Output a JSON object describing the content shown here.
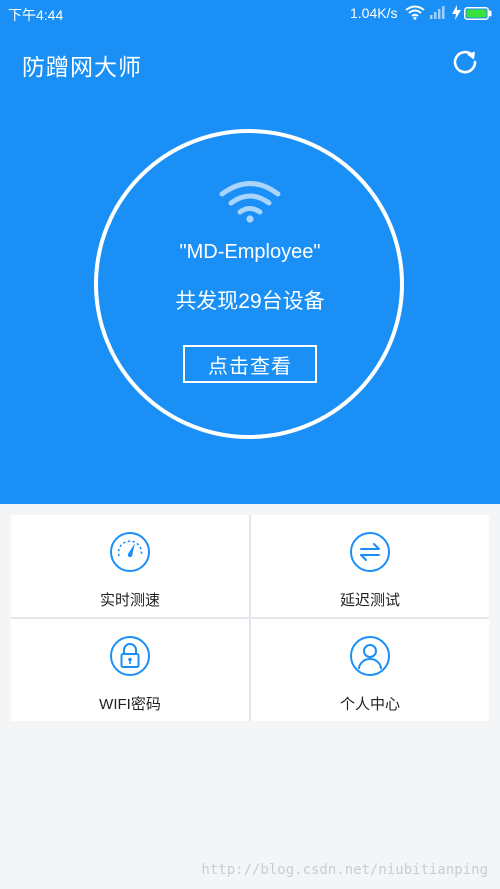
{
  "status_bar": {
    "time": "下午4:44",
    "net_speed": "1.04K/s"
  },
  "app": {
    "title": "防蹭网大师"
  },
  "scan": {
    "ssid": "\"MD-Employee\"",
    "found_text": "共发现29台设备",
    "view_button": "点击查看"
  },
  "features": [
    {
      "label": "实时测速",
      "icon": "speedometer-icon"
    },
    {
      "label": "延迟测试",
      "icon": "swap-arrows-icon"
    },
    {
      "label": "WIFI密码",
      "icon": "lock-icon"
    },
    {
      "label": "个人中心",
      "icon": "user-icon"
    }
  ],
  "watermark": "http://blog.csdn.net/niubitianping",
  "colors": {
    "primary": "#1a90f6",
    "background": "#f4f5f7",
    "icon_blue": "#1a90f6"
  }
}
